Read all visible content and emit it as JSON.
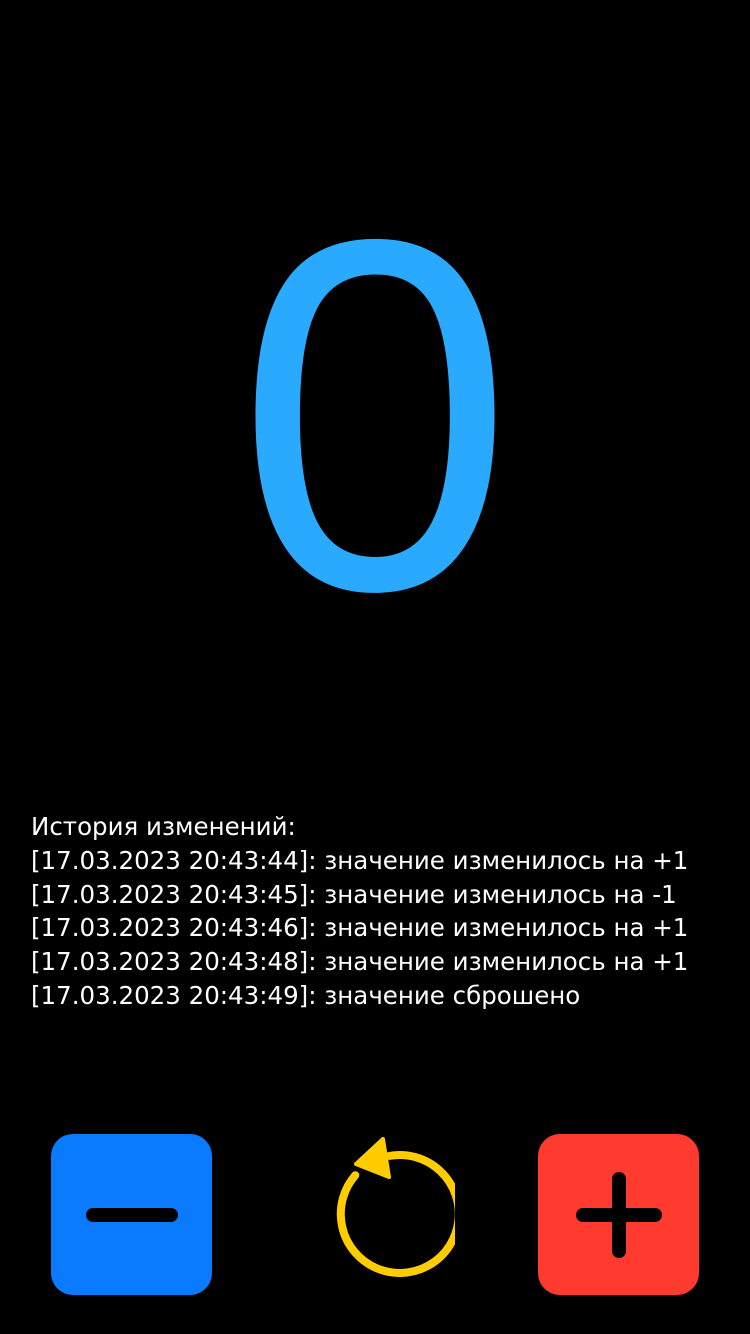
{
  "counter": {
    "value": "0",
    "color": "#2aaafe"
  },
  "history": {
    "title": "История изменений:",
    "entries": [
      "[17.03.2023 20:43:44]: значение изменилось на +1",
      "[17.03.2023 20:43:45]: значение изменилось на -1",
      "[17.03.2023 20:43:46]: значение изменилось на +1",
      "[17.03.2023 20:43:48]: значение изменилось на +1",
      "[17.03.2023 20:43:49]: значение сброшено"
    ]
  },
  "controls": {
    "decrement": {
      "icon": "minus-icon",
      "color": "#0a7aff"
    },
    "reset": {
      "icon": "reset-arrow-icon",
      "color": "#ffcc00"
    },
    "increment": {
      "icon": "plus-icon",
      "color": "#ff3b30"
    }
  }
}
